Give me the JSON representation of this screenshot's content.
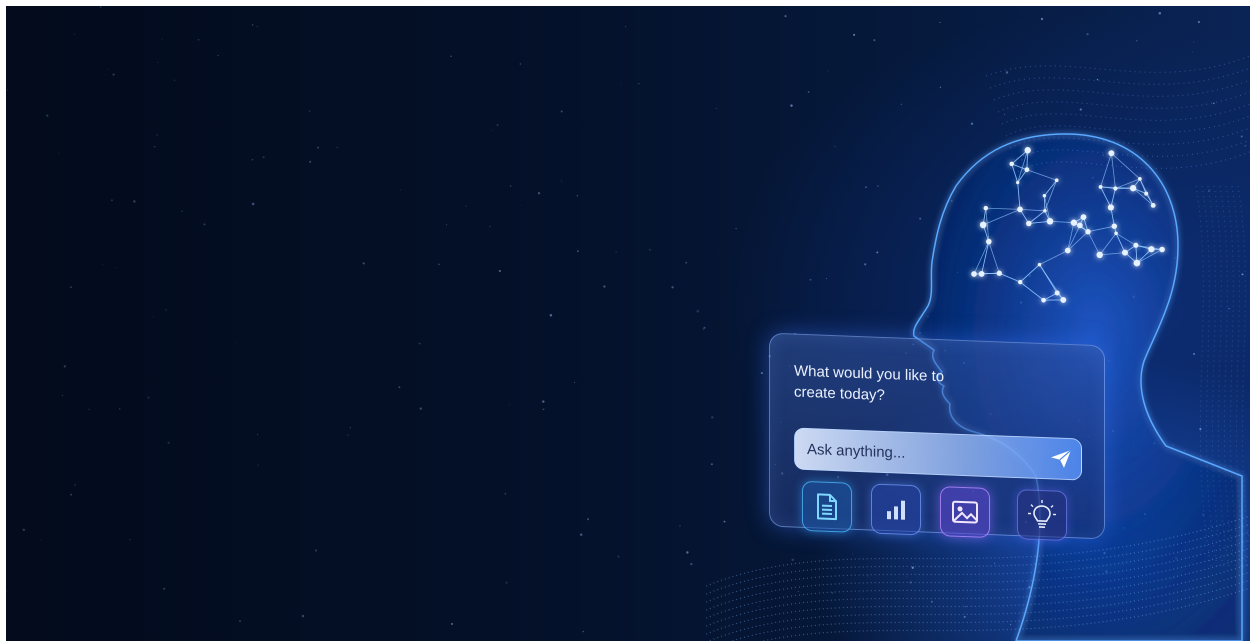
{
  "prompt": {
    "title": "What would you like to create today?",
    "input_placeholder": "Ask anything...",
    "input_value": ""
  },
  "actions": [
    {
      "name": "document",
      "icon": "document-icon"
    },
    {
      "name": "chart",
      "icon": "bar-chart-icon"
    },
    {
      "name": "image",
      "icon": "image-icon"
    },
    {
      "name": "idea",
      "icon": "lightbulb-icon"
    }
  ],
  "send_icon": "send-icon",
  "colors": {
    "background_dark": "#030b1c",
    "glow_blue": "#2f7bff",
    "card_border": "#8cb4ff",
    "node_white": "#e6f2ff"
  }
}
